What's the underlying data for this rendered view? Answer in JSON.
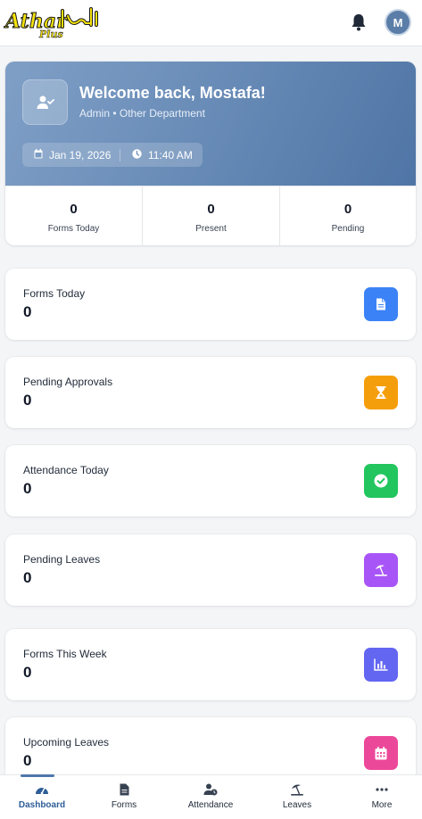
{
  "header": {
    "logo_text": "Athar Plus",
    "avatar_initial": "M"
  },
  "welcome": {
    "title": "Welcome back, Mostafa!",
    "subtitle": "Admin • Other Department",
    "date": "Jan 19, 2026",
    "time": "11:40 AM",
    "stats": [
      {
        "value": "0",
        "label": "Forms Today"
      },
      {
        "value": "0",
        "label": "Present"
      },
      {
        "value": "0",
        "label": "Pending"
      }
    ]
  },
  "cards": [
    {
      "label": "Forms Today",
      "value": "0",
      "icon": "document-icon",
      "color": "#3b82f6"
    },
    {
      "label": "Pending Approvals",
      "value": "0",
      "icon": "hourglass-icon",
      "color": "#f59e0b"
    },
    {
      "label": "Attendance Today",
      "value": "0",
      "icon": "check-circle-icon",
      "color": "#22c55e"
    },
    {
      "label": "Pending Leaves",
      "value": "0",
      "icon": "umbrella-beach-icon",
      "color": "#a855f7"
    },
    {
      "label": "Forms This Week",
      "value": "0",
      "icon": "bar-chart-icon",
      "color": "#6366f1"
    },
    {
      "label": "Upcoming Leaves",
      "value": "0",
      "icon": "calendar-icon",
      "color": "#ec4899"
    }
  ],
  "nav": [
    {
      "label": "Dashboard",
      "icon": "gauge-icon",
      "active": true
    },
    {
      "label": "Forms",
      "icon": "file-icon",
      "active": false
    },
    {
      "label": "Attendance",
      "icon": "user-clock-icon",
      "active": false
    },
    {
      "label": "Leaves",
      "icon": "umbrella-beach-icon",
      "active": false
    },
    {
      "label": "More",
      "icon": "ellipsis-icon",
      "active": false
    }
  ]
}
